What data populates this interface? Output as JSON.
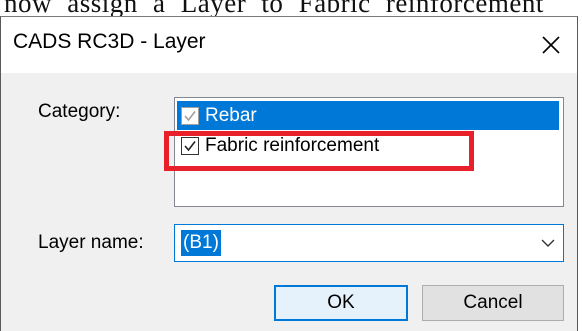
{
  "caption": {
    "text": "now assign a Layer to Fabric reinforcement"
  },
  "dialog": {
    "title": "CADS RC3D - Layer",
    "close_icon": "close-icon"
  },
  "category": {
    "label": "Category:",
    "items": [
      {
        "label": "Rebar",
        "checked": true,
        "selected": true
      },
      {
        "label": "Fabric reinforcement",
        "checked": true,
        "selected": false
      }
    ]
  },
  "layer": {
    "label": "Layer name:",
    "value": "(B1)",
    "dropdown_icon": "chevron-down-icon"
  },
  "buttons": {
    "ok": "OK",
    "cancel": "Cancel"
  },
  "colors": {
    "selection": "#0078d7",
    "highlight": "#e8202a",
    "dialog_bg": "#f0f0f0"
  }
}
